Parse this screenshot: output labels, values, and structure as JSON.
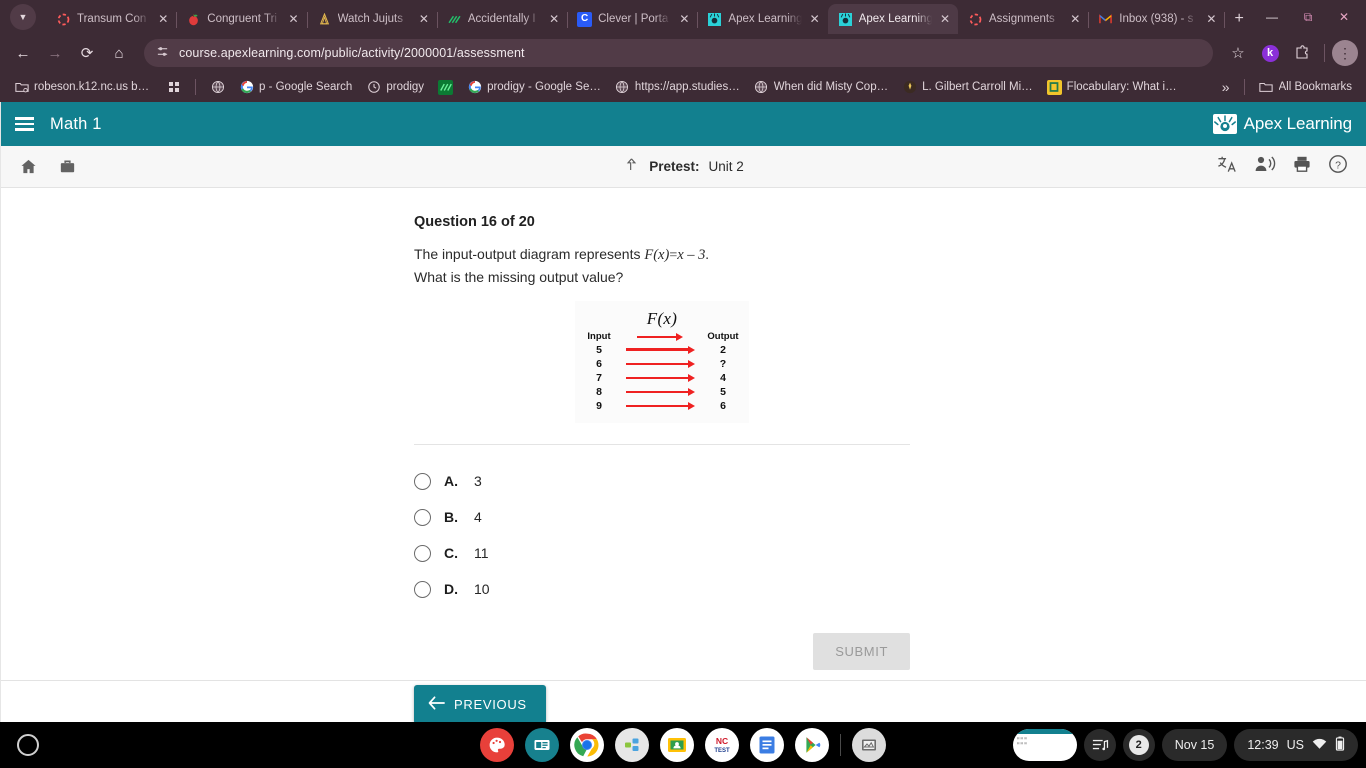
{
  "browser": {
    "tab_search_icon": "chevron-down-icon",
    "tabs": [
      {
        "title": "Transum Con",
        "favicon": "loading-spinner",
        "active": false
      },
      {
        "title": "Congruent Tri",
        "favicon": "apple-red",
        "active": false
      },
      {
        "title": "Watch Jujuts",
        "favicon": "crunchyroll",
        "active": false
      },
      {
        "title": "Accidentally I",
        "favicon": "green-stripes",
        "active": false
      },
      {
        "title": "Clever | Porta",
        "favicon": "clever-c",
        "active": false
      },
      {
        "title": "Apex Learning",
        "favicon": "apex-mark",
        "active": false
      },
      {
        "title": "Apex Learning",
        "favicon": "apex-mark",
        "active": true
      },
      {
        "title": "Assignments",
        "favicon": "loading-spinner",
        "active": false
      },
      {
        "title": "Inbox (938) - s",
        "favicon": "gmail-m",
        "active": false
      }
    ],
    "new_tab_label": "+",
    "window_controls": {
      "minimize": "—",
      "maximize": "⧉",
      "close": "✕"
    },
    "nav": {
      "back": "←",
      "forward": "→",
      "reload": "⟳",
      "home": "⌂"
    },
    "omnibox": {
      "site_icon": "tune-icon",
      "url": "course.apexlearning.com/public/activity/2000001/assessment"
    },
    "toolbar_right": {
      "bookmark_star": "☆",
      "extension_badge": "k",
      "extensions_icon": "puzzle-icon",
      "profile_icon": "⋮"
    },
    "bookmarks": [
      {
        "label": "robeson.k12.nc.us bookmarks",
        "icon": "folder-settings"
      },
      {
        "label": "",
        "icon": "apps-grid"
      },
      {
        "label": "",
        "icon": "globe"
      },
      {
        "label": "p - Google Search",
        "icon": "google-g"
      },
      {
        "label": "prodigy",
        "icon": "history-clock"
      },
      {
        "label": "",
        "icon": "green-stripes"
      },
      {
        "label": "prodigy - Google Se…",
        "icon": "google-g"
      },
      {
        "label": "https://app.studies…",
        "icon": "globe"
      },
      {
        "label": "When did Misty Cop…",
        "icon": "globe"
      },
      {
        "label": "L. Gilbert Carroll Mi…",
        "icon": "school-crest"
      },
      {
        "label": "Flocabulary: What i…",
        "icon": "flocabulary"
      }
    ],
    "bookmarks_overflow": "»",
    "all_bookmarks_label": "All Bookmarks",
    "all_bookmarks_icon": "folder-icon"
  },
  "app": {
    "header": {
      "menu_icon": "hamburger-menu-icon",
      "course_title": "Math 1",
      "brand_name": "Apex Learning",
      "brand_icon": "apex-logo-icon",
      "accent_color": "#12808f"
    },
    "subheader": {
      "home_icon": "home-icon",
      "briefcase_icon": "briefcase-icon",
      "upload_icon": "upload-arrow-icon",
      "activity_type": "Pretest:",
      "activity_name": "Unit 2",
      "translate_icon": "translate-icon",
      "read-aloud_icon": "read-aloud-icon",
      "print_icon": "print-icon",
      "help_icon": "help-circle-icon"
    }
  },
  "question": {
    "title": "Question 16 of 20",
    "prompt_part1": "The input-output diagram represents",
    "prompt_fx": "F(x)",
    "prompt_equals": "=",
    "prompt_expr": "x – 3",
    "prompt_period": ".",
    "prompt_line2": "What is the missing output value?",
    "choices": [
      {
        "letter": "A.",
        "text": "3",
        "selected": false
      },
      {
        "letter": "B.",
        "text": "4",
        "selected": false
      },
      {
        "letter": "C.",
        "text": "11",
        "selected": false
      },
      {
        "letter": "D.",
        "text": "10",
        "selected": false
      }
    ],
    "submit_label": "SUBMIT",
    "submit_enabled": false,
    "previous_label": "PREVIOUS",
    "previous_icon": "arrow-left-icon"
  },
  "chart_data": {
    "type": "diagram",
    "title": "F(x)",
    "input_label": "Input",
    "output_label": "Output",
    "arrow_color": "#ef2121",
    "pairs": [
      {
        "input": "5",
        "output": "2"
      },
      {
        "input": "6",
        "output": "?"
      },
      {
        "input": "7",
        "output": "4"
      },
      {
        "input": "8",
        "output": "5"
      },
      {
        "input": "9",
        "output": "6"
      }
    ]
  },
  "shelf": {
    "launcher_icon": "launcher-circle-icon",
    "apps": [
      {
        "name": "canvas-paint-app",
        "glyph": "✎",
        "running": false
      },
      {
        "name": "news-app",
        "glyph": "▤",
        "running": false
      },
      {
        "name": "chrome-browser",
        "glyph": "chrome",
        "running": true
      },
      {
        "name": "files-app",
        "glyph": "❖",
        "running": false
      },
      {
        "name": "google-classroom",
        "glyph": "⚑",
        "running": false
      },
      {
        "name": "nc-test-app",
        "glyph": "NC",
        "running": false
      },
      {
        "name": "google-docs",
        "glyph": "☰",
        "running": false
      },
      {
        "name": "play-store",
        "glyph": "▶",
        "running": false
      },
      {
        "name": "screen-capture-app",
        "glyph": "▦",
        "running": true
      }
    ],
    "tray": {
      "window_preview": "window-preview",
      "media_icon": "media-playlist-icon",
      "notification_count": "2",
      "date": "Nov 15",
      "time": "12:39",
      "locale": "US",
      "wifi_icon": "wifi-icon",
      "battery_icon": "battery-icon"
    }
  }
}
